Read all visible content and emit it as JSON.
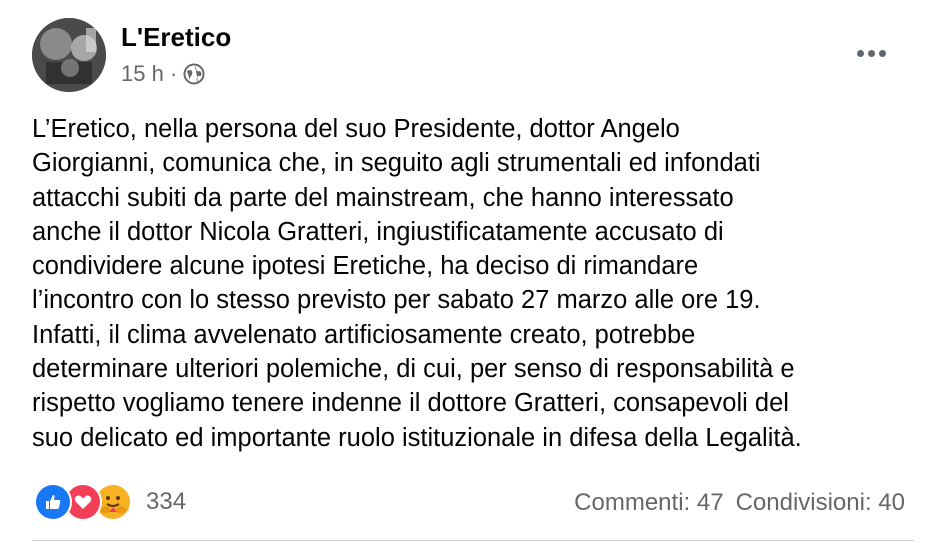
{
  "post": {
    "author": "L'Eretico",
    "time": "15 h",
    "separator": "·",
    "privacy_icon": "globe-icon",
    "more_icon": "more-horizontal-icon",
    "text": "L’Eretico, nella persona del suo Presidente, dottor Angelo\nGiorgianni,  comunica che, in seguito agli strumentali ed infondati\nattacchi subiti da parte del mainstream, che hanno interessato\nanche il dottor Nicola Gratteri,  ingiustificatamente accusato di\ncondividere alcune ipotesi Eretiche, ha deciso di rimandare\nl’incontro con lo stesso previsto per sabato 27 marzo alle ore 19.\nInfatti, il clima avvelenato artificiosamente creato, potrebbe\ndeterminare ulteriori  polemiche, di cui, per senso di responsabilità e\nrispetto vogliamo tenere indenne il dottore Gratteri, consapevoli del\nsuo delicato ed importante ruolo istituzionale in difesa della Legalità."
  },
  "reactions": {
    "icons": [
      "like-icon",
      "love-icon",
      "care-icon"
    ],
    "count": "334"
  },
  "stats": {
    "comments": "Commenti: 47",
    "shares": "Condivisioni: 40"
  },
  "colors": {
    "like": "#1877f2",
    "love": "#f33e58",
    "care": "#f7b125",
    "secondary_text": "#65676b"
  }
}
